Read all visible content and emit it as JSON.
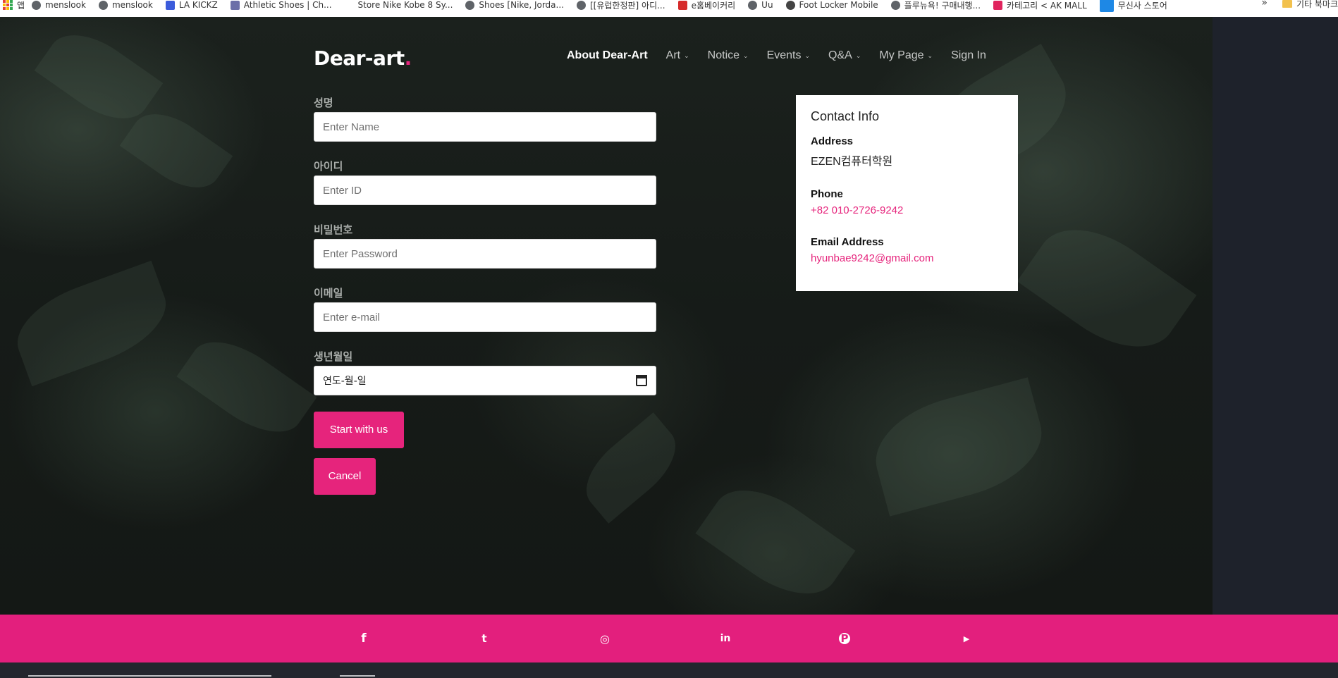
{
  "bookmarks": [
    {
      "label": "menslook",
      "icon": "globe-icon"
    },
    {
      "label": "menslook",
      "icon": "globe-icon"
    },
    {
      "label": "LA KICKZ",
      "icon": "bookmark-icon"
    },
    {
      "label": "Athletic Shoes | Ch...",
      "icon": "bookmark-icon"
    },
    {
      "label": "Store Nike Kobe 8 Sy...",
      "icon": "bookmark-icon"
    },
    {
      "label": "Shoes [Nike, Jorda...",
      "icon": "globe-icon"
    },
    {
      "label": "[[유럽한정판] 아디...",
      "icon": "globe-icon"
    },
    {
      "label": "e홈베이커리",
      "icon": "bookmark-icon"
    },
    {
      "label": "Uu",
      "icon": "globe-icon"
    },
    {
      "label": "Foot Locker Mobile",
      "icon": "bookmark-icon"
    },
    {
      "label": "플루뉴욕! 구매내행...",
      "icon": "globe-icon"
    },
    {
      "label": "카테고리 < AK MALL",
      "icon": "bookmark-icon"
    },
    {
      "label": "무신사 스토어",
      "icon": "bookmark-icon"
    }
  ],
  "bookmarks_more": "»",
  "bookmarks_other": "기타 북마크",
  "logo": {
    "text": "Dear-art",
    "dot": "."
  },
  "nav": [
    {
      "label": "About Dear-Art",
      "dropdown": false,
      "active": true
    },
    {
      "label": "Art",
      "dropdown": true
    },
    {
      "label": "Notice",
      "dropdown": true
    },
    {
      "label": "Events",
      "dropdown": true
    },
    {
      "label": "Q&A",
      "dropdown": true
    },
    {
      "label": "My Page",
      "dropdown": true
    },
    {
      "label": "Sign In",
      "dropdown": false
    }
  ],
  "form": {
    "name": {
      "label": "성명",
      "placeholder": "Enter Name"
    },
    "id": {
      "label": "아이디",
      "placeholder": "Enter ID"
    },
    "password": {
      "label": "비밀번호",
      "placeholder": "Enter Password"
    },
    "email": {
      "label": "이메일",
      "placeholder": "Enter e-mail"
    },
    "birth": {
      "label": "생년월일",
      "value": "연도-월-일"
    },
    "start_label": "Start with us",
    "cancel_label": "Cancel"
  },
  "contact": {
    "title": "Contact Info",
    "address_label": "Address",
    "address": "EZEN컴퓨터학원",
    "phone_label": "Phone",
    "phone": "+82 010-2726-9242",
    "email_label": "Email Address",
    "email": "hyunbae9242@gmail.com"
  },
  "social": [
    {
      "icon": "facebook-icon",
      "glyph": "f"
    },
    {
      "icon": "twitter-icon",
      "glyph": "t"
    },
    {
      "icon": "instagram-icon",
      "glyph": "◎"
    },
    {
      "icon": "linkedin-icon",
      "glyph": "in"
    },
    {
      "icon": "pinterest-icon",
      "glyph": "P"
    },
    {
      "icon": "youtube-icon",
      "glyph": "▶"
    }
  ],
  "colors": {
    "accent": "#e6247c",
    "footer": "#e31f7d",
    "dark": "#1e222b"
  }
}
